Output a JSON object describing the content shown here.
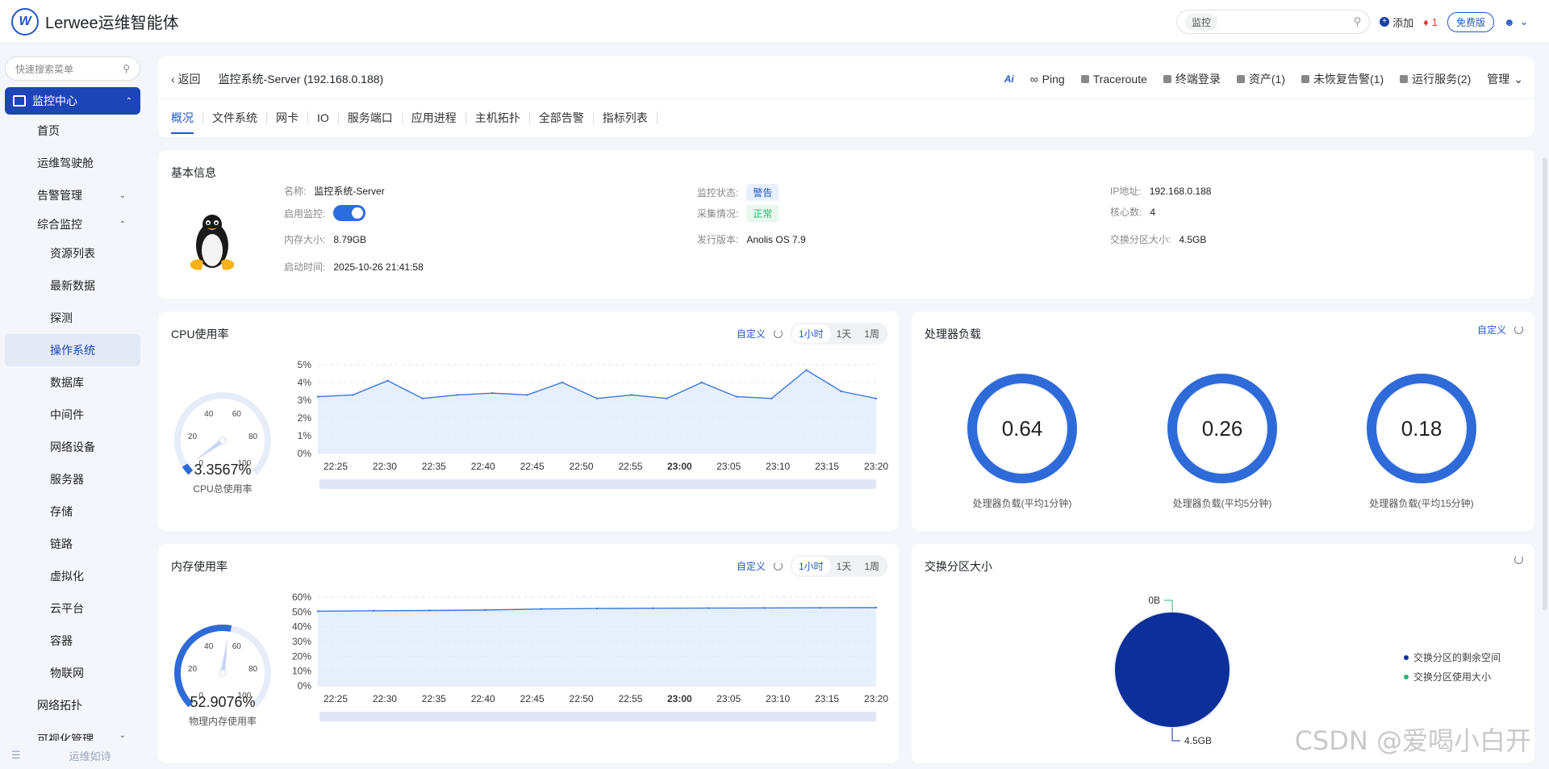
{
  "app": {
    "title": "Lerwee运维智能体"
  },
  "topbar": {
    "search_scope": "监控",
    "add_label": "添加",
    "alert_count": "1",
    "free_label": "免费版"
  },
  "sidebar": {
    "search_placeholder": "快速搜索菜单",
    "active_group": "监控中心",
    "items": [
      {
        "label": "首页"
      },
      {
        "label": "运维驾驶舱"
      },
      {
        "label": "告警管理"
      },
      {
        "label": "综合监控"
      },
      {
        "label": "资源列表"
      },
      {
        "label": "最新数据"
      },
      {
        "label": "探测"
      },
      {
        "label": "操作系统"
      },
      {
        "label": "数据库"
      },
      {
        "label": "中间件"
      },
      {
        "label": "网络设备"
      },
      {
        "label": "服务器"
      },
      {
        "label": "存储"
      },
      {
        "label": "链路"
      },
      {
        "label": "虚拟化"
      },
      {
        "label": "云平台"
      },
      {
        "label": "容器"
      },
      {
        "label": "物联网"
      },
      {
        "label": "网络拓扑"
      },
      {
        "label": "可视化管理"
      }
    ],
    "bottom_label": "运维如诗"
  },
  "header": {
    "back_label": "返回",
    "title": "监控系统-Server (192.168.0.188)",
    "actions": {
      "ai": "Ai",
      "ping": "Ping",
      "traceroute": "Traceroute",
      "terminal": "终端登录",
      "assets": "资产(1)",
      "unrecovered": "未恢复告警(1)",
      "services": "运行服务(2)",
      "manage": "管理"
    },
    "tabs": [
      "概况",
      "文件系统",
      "网卡",
      "IO",
      "服务端口",
      "应用进程",
      "主机拓扑",
      "全部告警",
      "指标列表"
    ]
  },
  "basic": {
    "title": "基本信息",
    "name_k": "名称:",
    "name_v": "监控系统-Server",
    "enable_k": "启用监控:",
    "mem_k": "内存大小:",
    "mem_v": "8.79GB",
    "boot_k": "启动时间:",
    "boot_v": "2025-10-26 21:41:58",
    "status_k": "监控状态:",
    "status_v": "警告",
    "collect_k": "采集情况:",
    "collect_v": "正常",
    "release_k": "发行版本:",
    "release_v": "Anolis OS 7.9",
    "ip_k": "IP地址:",
    "ip_v": "192.168.0.188",
    "cores_k": "核心数:",
    "cores_v": "4",
    "swap_k": "交换分区大小:",
    "swap_v": "4.5GB"
  },
  "cpu": {
    "title": "CPU使用率",
    "custom": "自定义",
    "ranges": [
      "1小时",
      "1天",
      "1周"
    ],
    "gauge_value": "3.3567%",
    "gauge_label": "CPU总使用率",
    "gauge_ticks": [
      "0",
      "20",
      "40",
      "60",
      "80",
      "100"
    ]
  },
  "load": {
    "title": "处理器负载",
    "custom": "自定义",
    "rings": [
      {
        "value": "0.64",
        "label": "处理器负载(平均1分钟)"
      },
      {
        "value": "0.26",
        "label": "处理器负载(平均5分钟)"
      },
      {
        "value": "0.18",
        "label": "处理器负载(平均15分钟)"
      }
    ]
  },
  "mem": {
    "title": "内存使用率",
    "custom": "自定义",
    "ranges": [
      "1小时",
      "1天",
      "1周"
    ],
    "gauge_value": "52.9076%",
    "gauge_label": "物理内存使用率",
    "gauge_ticks": [
      "0",
      "20",
      "40",
      "60",
      "80",
      "100"
    ]
  },
  "swap": {
    "title": "交换分区大小",
    "top_label": "0B",
    "bottom_label": "4.5GB",
    "legend": [
      "交换分区的剩余空间",
      "交换分区使用大小"
    ]
  },
  "watermark": "CSDN @爱喝小白开",
  "colors": {
    "primary": "#1d45b7",
    "accent": "#2b6de0",
    "ok": "#2bb673",
    "swap_free": "#0d2f9a",
    "swap_used": "#2bb673"
  },
  "chart_data": [
    {
      "type": "area",
      "title": "CPU使用率",
      "x": [
        "22:25",
        "22:30",
        "22:35",
        "22:40",
        "22:45",
        "22:50",
        "22:55",
        "23:00",
        "23:05",
        "23:10",
        "23:15",
        "23:20"
      ],
      "y_ticks": [
        "0%",
        "1%",
        "2%",
        "3%",
        "4%",
        "5%"
      ],
      "ylim": [
        0,
        5
      ],
      "series": [
        {
          "values": [
            3.2,
            3.3,
            4.1,
            3.1,
            3.3,
            3.4,
            3.3,
            4.0,
            3.1,
            3.3,
            3.1,
            4.0,
            3.2,
            3.1,
            4.7,
            3.5,
            3.1
          ]
        }
      ]
    },
    {
      "type": "area",
      "title": "内存使用率",
      "x": [
        "22:25",
        "22:30",
        "22:35",
        "22:40",
        "22:45",
        "22:50",
        "22:55",
        "23:00",
        "23:05",
        "23:10",
        "23:15",
        "23:20"
      ],
      "y_ticks": [
        "0%",
        "10%",
        "20%",
        "30%",
        "40%",
        "50%",
        "60%"
      ],
      "ylim": [
        0,
        60
      ],
      "series": [
        {
          "values": [
            50.5,
            50.8,
            51.0,
            51.3,
            52.0,
            52.3,
            52.5,
            52.6,
            52.7,
            52.8,
            52.9
          ]
        }
      ]
    },
    {
      "type": "pie",
      "title": "交换分区大小",
      "categories": [
        "交换分区的剩余空间",
        "交换分区使用大小"
      ],
      "values": [
        4.5,
        0
      ],
      "units": "GB"
    }
  ]
}
